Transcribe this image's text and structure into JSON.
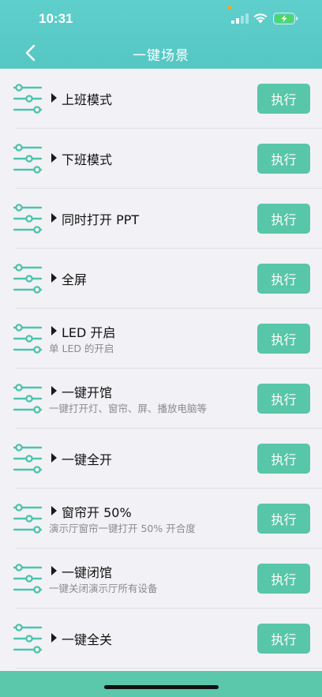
{
  "status": {
    "time": "10:31"
  },
  "header": {
    "title": "一键场景"
  },
  "scenes": [
    {
      "title": "上班模式",
      "subtitle": "",
      "button": "执行"
    },
    {
      "title": "下班模式",
      "subtitle": "",
      "button": "执行"
    },
    {
      "title": "同时打开 PPT",
      "subtitle": "",
      "button": "执行"
    },
    {
      "title": "全屏",
      "subtitle": "",
      "button": "执行"
    },
    {
      "title": "LED 开启",
      "subtitle": "单 LED 的开启",
      "button": "执行"
    },
    {
      "title": "一键开馆",
      "subtitle": "一键打开灯、窗帘、屏、播放电脑等",
      "button": "执行"
    },
    {
      "title": "一键全开",
      "subtitle": "",
      "button": "执行"
    },
    {
      "title": "窗帘开 50%",
      "subtitle": "演示厅窗帘一键打开 50% 开合度",
      "button": "执行"
    },
    {
      "title": "一键闭馆",
      "subtitle": "一键关闭演示厅所有设备",
      "button": "执行"
    },
    {
      "title": "一键全关",
      "subtitle": "",
      "button": "执行"
    }
  ],
  "colors": {
    "header": "#55c7c3",
    "button": "#58c6a8",
    "icon": "#4fc4ad"
  }
}
